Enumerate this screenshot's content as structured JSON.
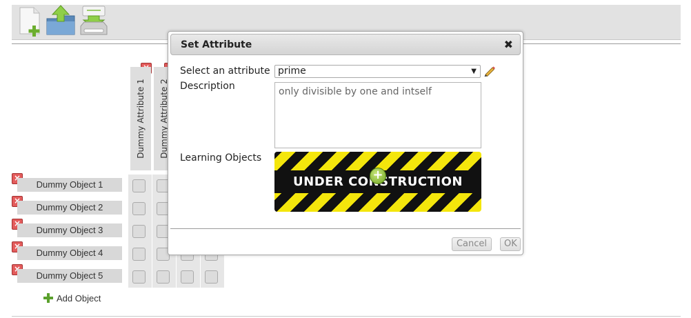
{
  "toolbar": {
    "buttons": [
      {
        "icon": "new-file-icon"
      },
      {
        "icon": "open-folder-icon"
      },
      {
        "icon": "save-drive-icon"
      }
    ]
  },
  "matrix": {
    "attributes": [
      {
        "label": "Dummy Attribute 1"
      },
      {
        "label": "Dummy Attribute 2"
      }
    ],
    "objects": [
      {
        "label": "Dummy Object 1"
      },
      {
        "label": "Dummy Object 2"
      },
      {
        "label": "Dummy Object 3"
      },
      {
        "label": "Dummy Object 4"
      },
      {
        "label": "Dummy Object 5"
      }
    ],
    "add_object_label": "Add Object",
    "delete_icon": "delete-x-icon"
  },
  "dialog": {
    "title": "Set Attribute",
    "close_glyph": "✖",
    "select_label": "Select an attribute",
    "selected_attribute": "prime",
    "description_label": "Description",
    "description_value": "only divisible by one and intself",
    "learning_objects_label": "Learning Objects",
    "under_construction_text": "UNDER CONSTRUCTION",
    "cancel_label": "Cancel",
    "ok_label": "OK"
  },
  "colors": {
    "accent_yellow": "#f4e60c",
    "delete_red": "#e35c5c",
    "add_green": "#5aa02c"
  }
}
